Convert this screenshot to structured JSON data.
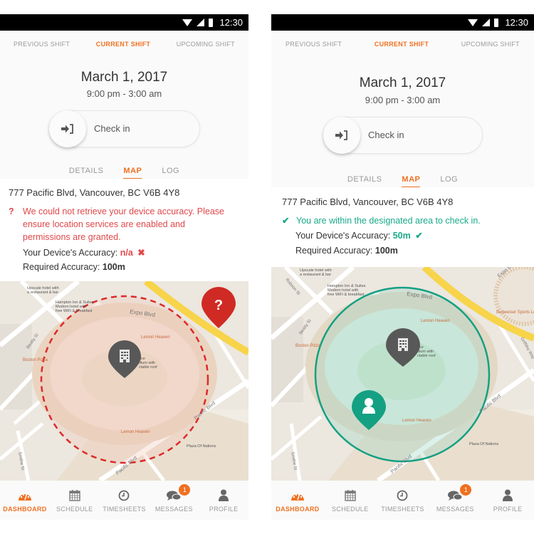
{
  "status_bar": {
    "time": "12:30"
  },
  "shift_tabs": [
    {
      "label": "Previous Shift"
    },
    {
      "label": "Current Shift",
      "active": true
    },
    {
      "label": "Upcoming Shift"
    }
  ],
  "shift": {
    "date": "March 1, 2017",
    "time_range": "9:00 pm - 3:00 am"
  },
  "checkin": {
    "label": "Check in",
    "icon": "sign-in-icon"
  },
  "detail_tabs": [
    {
      "label": "Details"
    },
    {
      "label": "Map",
      "active": true
    },
    {
      "label": "Log"
    }
  ],
  "location": {
    "address": "777 Pacific Blvd, Vancouver, BC V6B 4Y8"
  },
  "screens": {
    "left": {
      "status": "error",
      "message_icon": "?",
      "message": "We could not retrieve your device accuracy. Please ensure location services are enabled and permissions are granted.",
      "device_accuracy_label": "Your Device's Accuracy:",
      "device_accuracy_value": "n/a",
      "device_accuracy_icon": "✖",
      "required_accuracy_label": "Required Accuracy:",
      "required_accuracy_value": "100m",
      "pin_icon": "?"
    },
    "right": {
      "status": "ok",
      "message_icon": "✔",
      "message": "You are within the designated area to check in.",
      "device_accuracy_label": "Your Device's Accuracy:",
      "device_accuracy_value": "50m",
      "device_accuracy_icon": "✔",
      "required_accuracy_label": "Required Accuracy:",
      "required_accuracy_value": "100m"
    }
  },
  "map_labels": {
    "upscale_hotel_1": "Upscale hotel with",
    "upscale_hotel_2": "a restaurant & bar",
    "hampton_1": "Hampton Inn & Suites",
    "hampton_2": "Modern hotel with",
    "hampton_3": "free WiFi & breakfast",
    "expo_blvd": "Expo Blvd",
    "lemon_heaven": "Lemon Heaven",
    "boston_pizza": "Boston Pizza",
    "beatty_st": "Beatty St",
    "robson_st": "Robson St",
    "pacific_blvd": "Pacific Blvd",
    "smithe_st": "Smithe St",
    "plaza": "Plaza Of Nations",
    "sports": "Budweiser Sports Lo",
    "griffiths": "Griffiths Way",
    "stadium_1": "ace",
    "stadium_2": "dium with",
    "stadium_3": "ctable roof"
  },
  "bottom_nav": [
    {
      "label": "Dashboard",
      "icon": "dashboard-icon",
      "active": true
    },
    {
      "label": "Schedule",
      "icon": "calendar-icon"
    },
    {
      "label": "Timesheets",
      "icon": "clock-icon"
    },
    {
      "label": "Messages",
      "icon": "chat-icon",
      "badge": "1"
    },
    {
      "label": "Profile",
      "icon": "user-icon"
    }
  ],
  "colors": {
    "accent": "#f07020",
    "error": "#e0484a",
    "success": "#1aaa8a",
    "pin_dark": "#555555",
    "pin_error": "#d02a24"
  }
}
